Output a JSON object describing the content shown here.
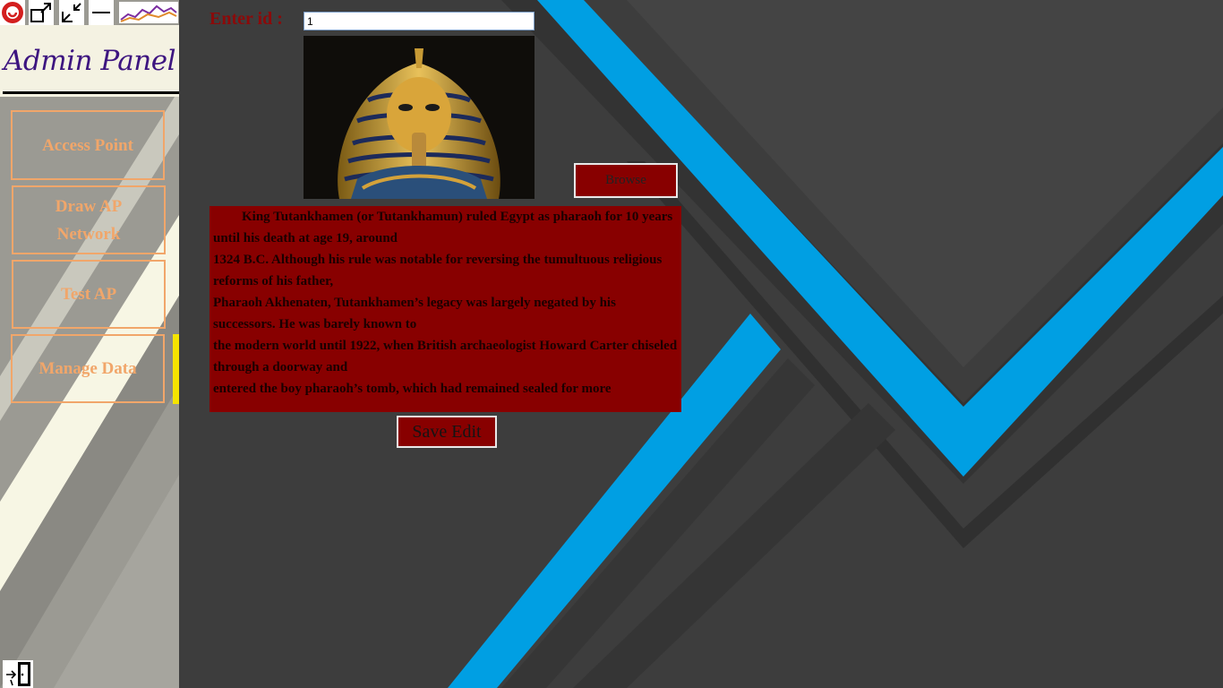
{
  "sidebar": {
    "title": "Admin Panel",
    "nav": [
      {
        "label": "Access Point"
      },
      {
        "label": "Draw AP Network"
      },
      {
        "label": "Test AP"
      },
      {
        "label": "Manage Data"
      }
    ],
    "active_index": 3
  },
  "window_controls": [
    "app-logo-icon",
    "maximize-icon",
    "restore-icon",
    "minimize-icon"
  ],
  "form": {
    "id_label": "Enter id :",
    "id_value": "1",
    "browse_label": "Browse",
    "description_lines": [
      "King Tutankhamen (or Tutankhamun) ruled Egypt as pharaoh for 10 years until his death at age 19, around",
      "1324 B.C. Although his rule was notable for reversing the tumultuous religious reforms of his father,",
      "Pharaoh Akhenaten, Tutankhamen’s legacy was largely negated by his successors. He was barely known to",
      "the modern world until 1922, when British archaeologist Howard Carter chiseled through a doorway and",
      "entered the boy pharaoh’s tomb, which had remained sealed for more"
    ],
    "save_label": "Save Edit"
  },
  "colors": {
    "accent_red": "#880000",
    "label_red": "#8b0a0a",
    "nav_orange": "#f1a66a",
    "active_yellow": "#f5e400",
    "stripe_blue": "#009fe3",
    "bg_gray": "#3c3c3c"
  }
}
